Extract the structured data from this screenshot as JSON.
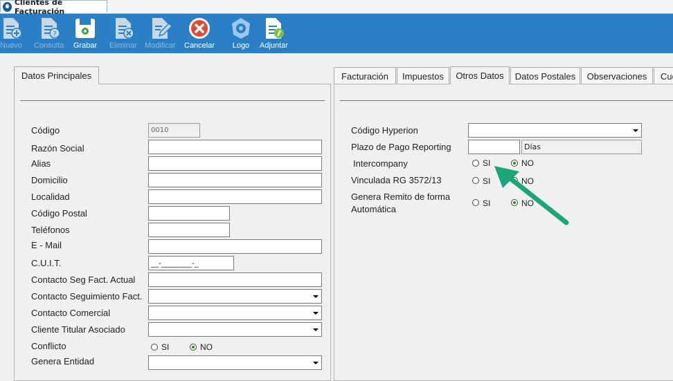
{
  "window": {
    "tab_title": "Clientes de Facturación"
  },
  "toolbar": {
    "nuevo": "Nuevo",
    "consulta": "Consulta",
    "grabar": "Grabar",
    "eliminar": "Eliminar",
    "modificar": "Modificar",
    "cancelar": "Cancelar",
    "logo": "Logo",
    "adjuntar": "Adjuntar"
  },
  "left": {
    "tab": "Datos Principales",
    "codigo_label": "Código",
    "codigo_value": "0010",
    "razon_label": "Razón Social",
    "alias_label": "Alias",
    "domicilio_label": "Domicilio",
    "localidad_label": "Localidad",
    "cp_label": "Código Postal",
    "tel_label": "Teléfonos",
    "email_label": "E - Mail",
    "cuit_label": "C.U.I.T.",
    "cuit_mask": "__-________-_",
    "contacto_seg_actual_label": "Contacto Seg Fact. Actual",
    "contacto_seguimiento_label": "Contacto Seguimiento Fact.",
    "contacto_comercial_label": "Contacto Comercial",
    "cliente_titular_label": "Cliente Titular Asociado",
    "conflicto_label": "Conflicto",
    "si": "SI",
    "no": "NO",
    "genera_entidad_label": "Genera Entidad"
  },
  "right": {
    "tabs": [
      "Facturación",
      "Impuestos",
      "Otros Datos",
      "Datos Postales",
      "Observaciones",
      "Cue"
    ],
    "codigo_hyperion_label": "Código Hyperion",
    "plazo_label": "Plazo de Pago Reporting",
    "dias": "Días",
    "intercompany_label": "Intercompany",
    "vinculada_label": "Vinculada RG 3572/13",
    "genera_remito_label_1": "Genera Remito de forma",
    "genera_remito_label_2": "Automática",
    "si": "SI",
    "no": "NO"
  },
  "colors": {
    "toolbar": "#2b80c5",
    "accent_line": "#2b80c5",
    "arrow": "#1aa57a"
  }
}
